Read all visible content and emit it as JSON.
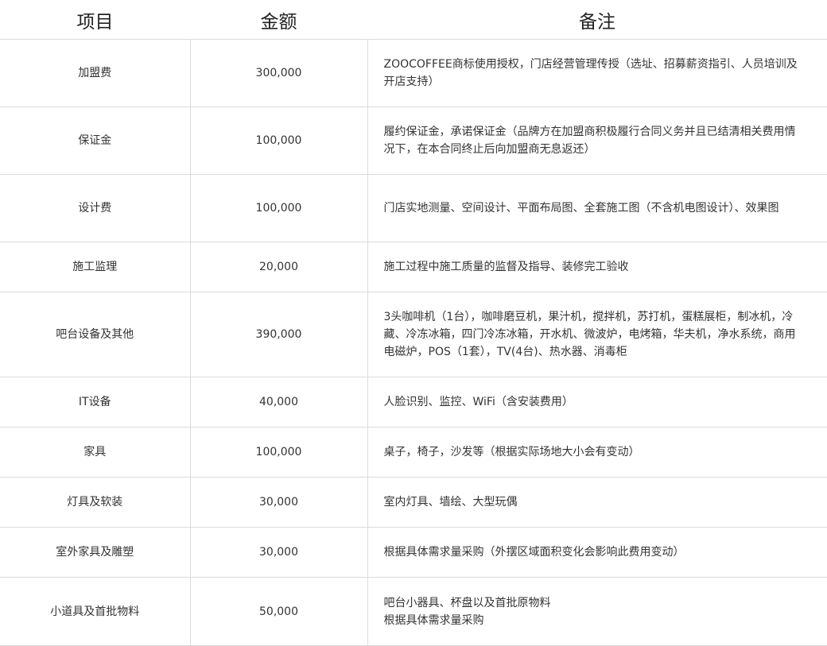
{
  "headers": {
    "item": "项目",
    "amount": "金额",
    "note": "备注"
  },
  "rows": [
    {
      "item": "加盟费",
      "amount": "300,000",
      "note": "ZOOCOFFEE商标使用授权，门店经营管理传授（选址、招募薪资指引、人员培训及开店支持）"
    },
    {
      "item": "保证金",
      "amount": "100,000",
      "note": "履约保证金，承诺保证金（品牌方在加盟商积极履行合同义务并且已结清相关费用情况下，在本合同终止后向加盟商无息返还）"
    },
    {
      "item": "设计费",
      "amount": "100,000",
      "note": "门店实地测量、空间设计、平面布局图、全套施工图（不含机电图设计）、效果图"
    },
    {
      "item": "施工监理",
      "amount": "20,000",
      "note": "施工过程中施工质量的监督及指导、装修完工验收"
    },
    {
      "item": "吧台设备及其他",
      "amount": "390,000",
      "note": "3头咖啡机（1台），咖啡磨豆机，果汁机，搅拌机，苏打机，蛋糕展柜，制冰机，冷藏、冷冻冰箱，四门冷冻冰箱，开水机、微波炉，电烤箱，华夫机，净水系统，商用电磁炉，POS（1套），TV(4台)、热水器、消毒柜"
    },
    {
      "item": "IT设备",
      "amount": "40,000",
      "note": "人脸识别、监控、WiFi（含安装费用）"
    },
    {
      "item": "家具",
      "amount": "100,000",
      "note": "桌子，椅子，沙发等（根据实际场地大小会有变动）"
    },
    {
      "item": "灯具及软装",
      "amount": "30,000",
      "note": "室内灯具、墙绘、大型玩偶"
    },
    {
      "item": "室外家具及雕塑",
      "amount": "30,000",
      "note": "根据具体需求量采购（外摆区域面积变化会影响此费用变动）"
    },
    {
      "item": "小道具及首批物料",
      "amount": "50,000",
      "note_line1": "吧台小器具、杯盘以及首批原物料",
      "note_line2": "根据具体需求量采购"
    }
  ]
}
